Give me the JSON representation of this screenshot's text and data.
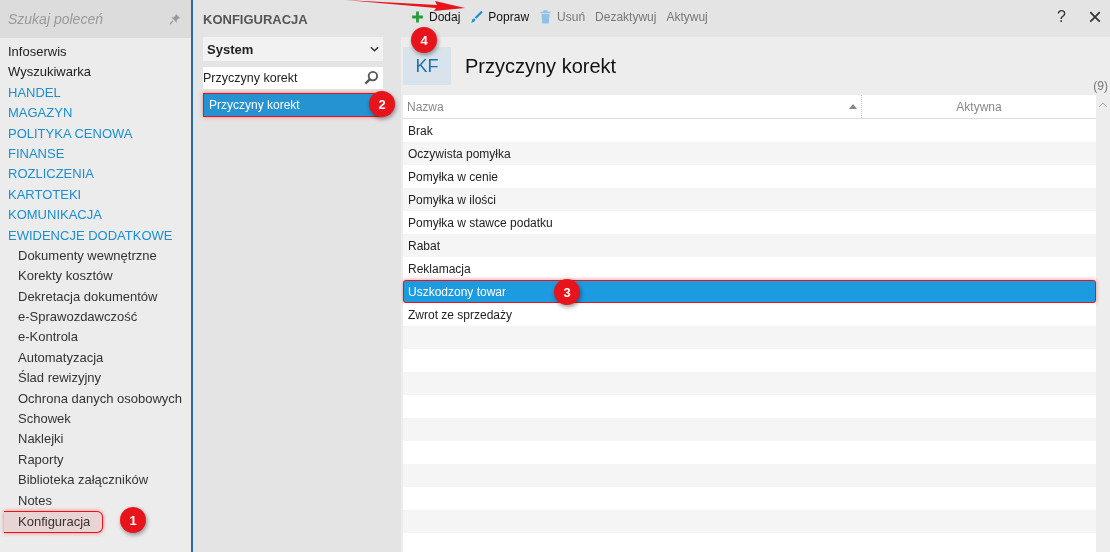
{
  "sidebar": {
    "search": {
      "placeholder": "Szukaj poleceń"
    },
    "items": [
      {
        "label": "Infoserwis",
        "kind": "link",
        "selected": false
      },
      {
        "label": "Wyszukiwarka",
        "kind": "link",
        "selected": false
      },
      {
        "label": "HANDEL",
        "kind": "section",
        "selected": false
      },
      {
        "label": "MAGAZYN",
        "kind": "section",
        "selected": false
      },
      {
        "label": "POLITYKA CENOWA",
        "kind": "section",
        "selected": false
      },
      {
        "label": "FINANSE",
        "kind": "section",
        "selected": false
      },
      {
        "label": "ROZLICZENIA",
        "kind": "section",
        "selected": false
      },
      {
        "label": "KARTOTEKI",
        "kind": "section",
        "selected": false
      },
      {
        "label": "KOMUNIKACJA",
        "kind": "section",
        "selected": false
      },
      {
        "label": "EWIDENCJE DODATKOWE",
        "kind": "section",
        "selected": false
      },
      {
        "label": "Dokumenty wewnętrzne",
        "kind": "sub",
        "selected": false
      },
      {
        "label": "Korekty kosztów",
        "kind": "sub",
        "selected": false
      },
      {
        "label": "Dekretacja dokumentów",
        "kind": "sub",
        "selected": false
      },
      {
        "label": "e-Sprawozdawczość",
        "kind": "sub",
        "selected": false
      },
      {
        "label": "e-Kontrola",
        "kind": "sub",
        "selected": false
      },
      {
        "label": "Automatyzacja",
        "kind": "sub",
        "selected": false
      },
      {
        "label": "Ślad rewizyjny",
        "kind": "sub",
        "selected": false
      },
      {
        "label": "Ochrona danych osobowych",
        "kind": "sub",
        "selected": false
      },
      {
        "label": "Schowek",
        "kind": "sub",
        "selected": false
      },
      {
        "label": "Naklejki",
        "kind": "sub",
        "selected": false
      },
      {
        "label": "Raporty",
        "kind": "sub",
        "selected": false
      },
      {
        "label": "Biblioteka załączników",
        "kind": "sub",
        "selected": false
      },
      {
        "label": "Notes",
        "kind": "sub",
        "selected": false
      },
      {
        "label": "Konfiguracja",
        "kind": "sub",
        "selected": true
      }
    ]
  },
  "config_panel": {
    "title": "KONFIGURACJA",
    "category": "System",
    "search": {
      "value": "Przyczyny korekt"
    },
    "items": [
      {
        "label": "Przyczyny korekt",
        "selected": true
      }
    ]
  },
  "toolbar": {
    "buttons": [
      {
        "label": "Dodaj",
        "kind": "add",
        "disabled": false
      },
      {
        "label": "Popraw",
        "kind": "edit",
        "disabled": false
      },
      {
        "label": "Usuń",
        "kind": "delete",
        "disabled": true
      },
      {
        "label": "Dezaktywuj",
        "kind": "none",
        "disabled": true
      },
      {
        "label": "Aktywuj",
        "kind": "none",
        "disabled": true
      }
    ],
    "help": "?",
    "close": "×"
  },
  "content": {
    "badge": "KF",
    "title": "Przyczyny korekt",
    "count": "(9)",
    "table": {
      "columns": [
        "Nazwa",
        "Aktywna"
      ],
      "rows": [
        {
          "name": "Brak",
          "selected": false
        },
        {
          "name": "Oczywista pomyłka",
          "selected": false
        },
        {
          "name": "Pomyłka w cenie",
          "selected": false
        },
        {
          "name": "Pomyłka w ilości",
          "selected": false
        },
        {
          "name": "Pomyłka w stawce podatku",
          "selected": false
        },
        {
          "name": "Rabat",
          "selected": false
        },
        {
          "name": "Reklamacja",
          "selected": false
        },
        {
          "name": "Uszkodzony towar",
          "selected": true
        },
        {
          "name": "Zwrot ze sprzedaży",
          "selected": false
        }
      ]
    }
  },
  "annotations": [
    {
      "label": "1"
    },
    {
      "label": "2"
    },
    {
      "label": "3"
    },
    {
      "label": "4"
    }
  ]
}
